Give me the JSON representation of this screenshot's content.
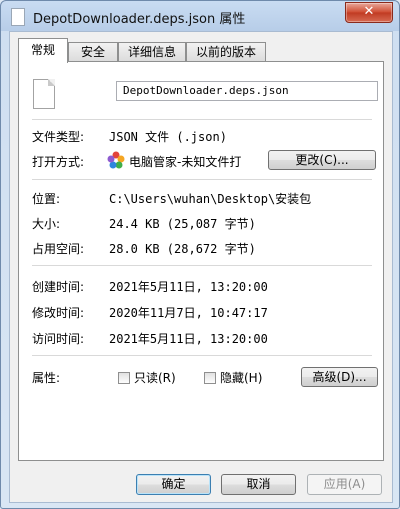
{
  "window": {
    "title": "DepotDownloader.deps.json 属性",
    "close_glyph": "✕"
  },
  "tabs": [
    {
      "label": "常规",
      "active": true
    },
    {
      "label": "安全",
      "active": false
    },
    {
      "label": "详细信息",
      "active": false
    },
    {
      "label": "以前的版本",
      "active": false
    }
  ],
  "general": {
    "file_name": "DepotDownloader.deps.json",
    "file_type_label": "文件类型:",
    "file_type_value": "JSON 文件 (.json)",
    "open_with_label": "打开方式:",
    "open_with_app": "电脑管家-未知文件打",
    "change_button": "更改(C)...",
    "location_label": "位置:",
    "location_value": "C:\\Users\\wuhan\\Desktop\\安装包",
    "size_label": "大小:",
    "size_value": "24.4 KB (25,087 字节)",
    "size_on_disk_label": "占用空间:",
    "size_on_disk_value": "28.0 KB (28,672 字节)",
    "created_label": "创建时间:",
    "created_value": "2021年5月11日, 13:20:00",
    "modified_label": "修改时间:",
    "modified_value": "2020年11月7日, 10:47:17",
    "accessed_label": "访问时间:",
    "accessed_value": "2021年5月11日, 13:20:00",
    "attributes_label": "属性:",
    "readonly_label": "只读(R)",
    "readonly_checked": false,
    "hidden_label": "隐藏(H)",
    "hidden_checked": false,
    "advanced_button": "高级(D)..."
  },
  "footer": {
    "ok_button": "确定",
    "cancel_button": "取消",
    "apply_button": "应用(A)"
  },
  "colors": {
    "title_gradient": "#c9dcf2",
    "close_button": "#c03a22",
    "app_icon_colors": [
      "#e2433b",
      "#f5a623",
      "#3fae49",
      "#2f86de",
      "#8e5bd0"
    ]
  }
}
